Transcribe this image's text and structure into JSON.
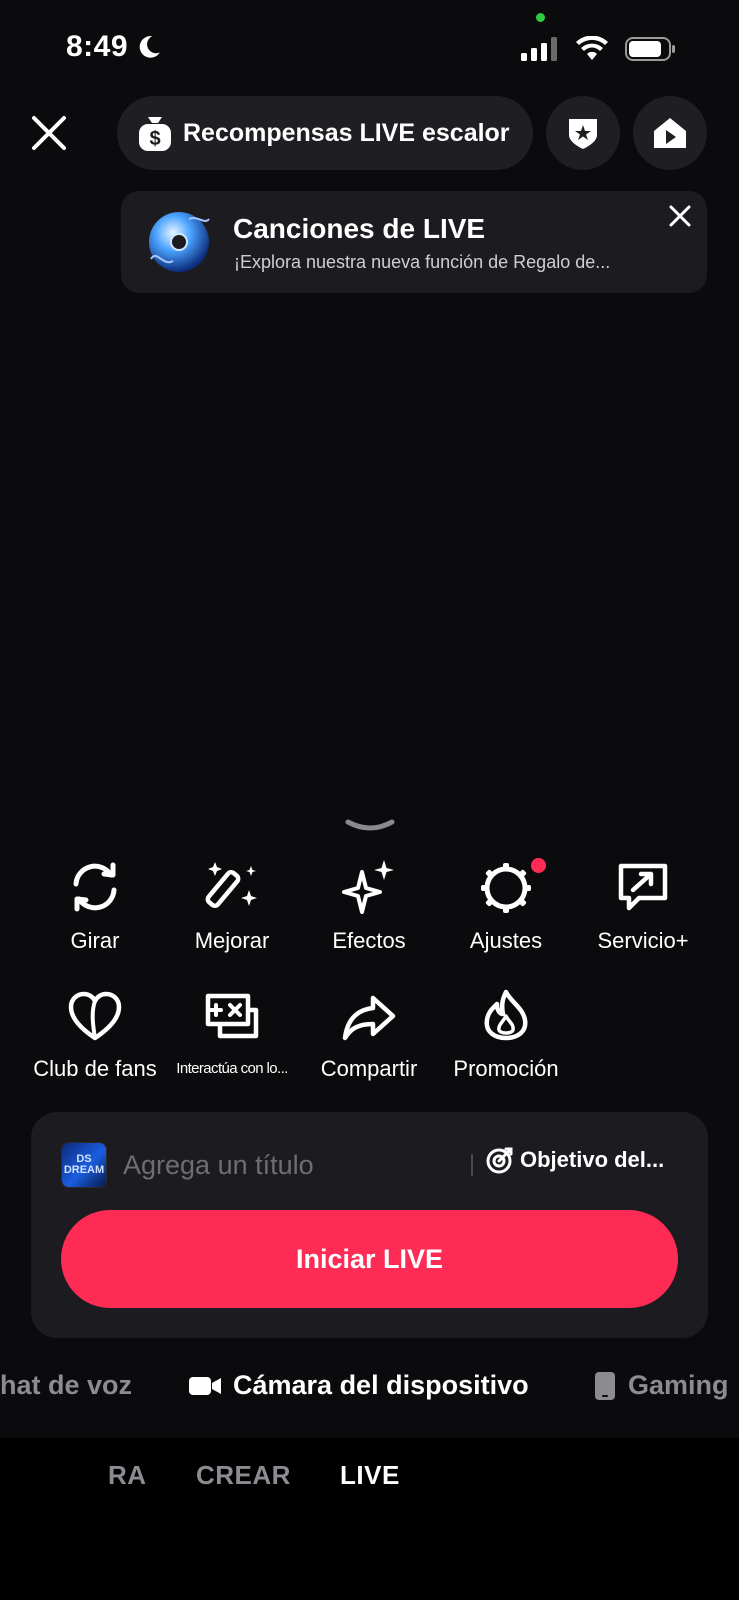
{
  "status": {
    "time": "8:49"
  },
  "header": {
    "rewards_label": "Recompensas LIVE escalor"
  },
  "banner": {
    "title": "Canciones de LIVE",
    "subtitle": "¡Explora nuestra nueva función de Regalo de..."
  },
  "tools": [
    {
      "label": "Girar",
      "icon": "rotate-icon"
    },
    {
      "label": "Mejorar",
      "icon": "magic-wand-icon"
    },
    {
      "label": "Efectos",
      "icon": "sparkles-icon"
    },
    {
      "label": "Ajustes",
      "icon": "gear-icon"
    },
    {
      "label": "Servicio+",
      "icon": "service-chat-icon"
    },
    {
      "label": "Club de fans",
      "icon": "heart-icon"
    },
    {
      "label": "Interactúa con lo...",
      "icon": "game-chat-icon"
    },
    {
      "label": "Compartir",
      "icon": "share-icon"
    },
    {
      "label": "Promoción",
      "icon": "flame-icon"
    }
  ],
  "panel": {
    "title_placeholder": "Agrega un título",
    "goal_label": "Objetivo del...",
    "start_label": "Iniciar LIVE",
    "app_icon_text": "DS DREAM"
  },
  "modes": {
    "left": "hat de voz",
    "active": "Cámara del dispositivo",
    "right": "Gaming"
  },
  "nav": {
    "left_partial": "RA",
    "create": "CREAR",
    "live": "LIVE"
  },
  "colors": {
    "accent": "#fe2c55",
    "notification_dot": "#fe2c55",
    "camera_dot": "#2ecc40"
  }
}
